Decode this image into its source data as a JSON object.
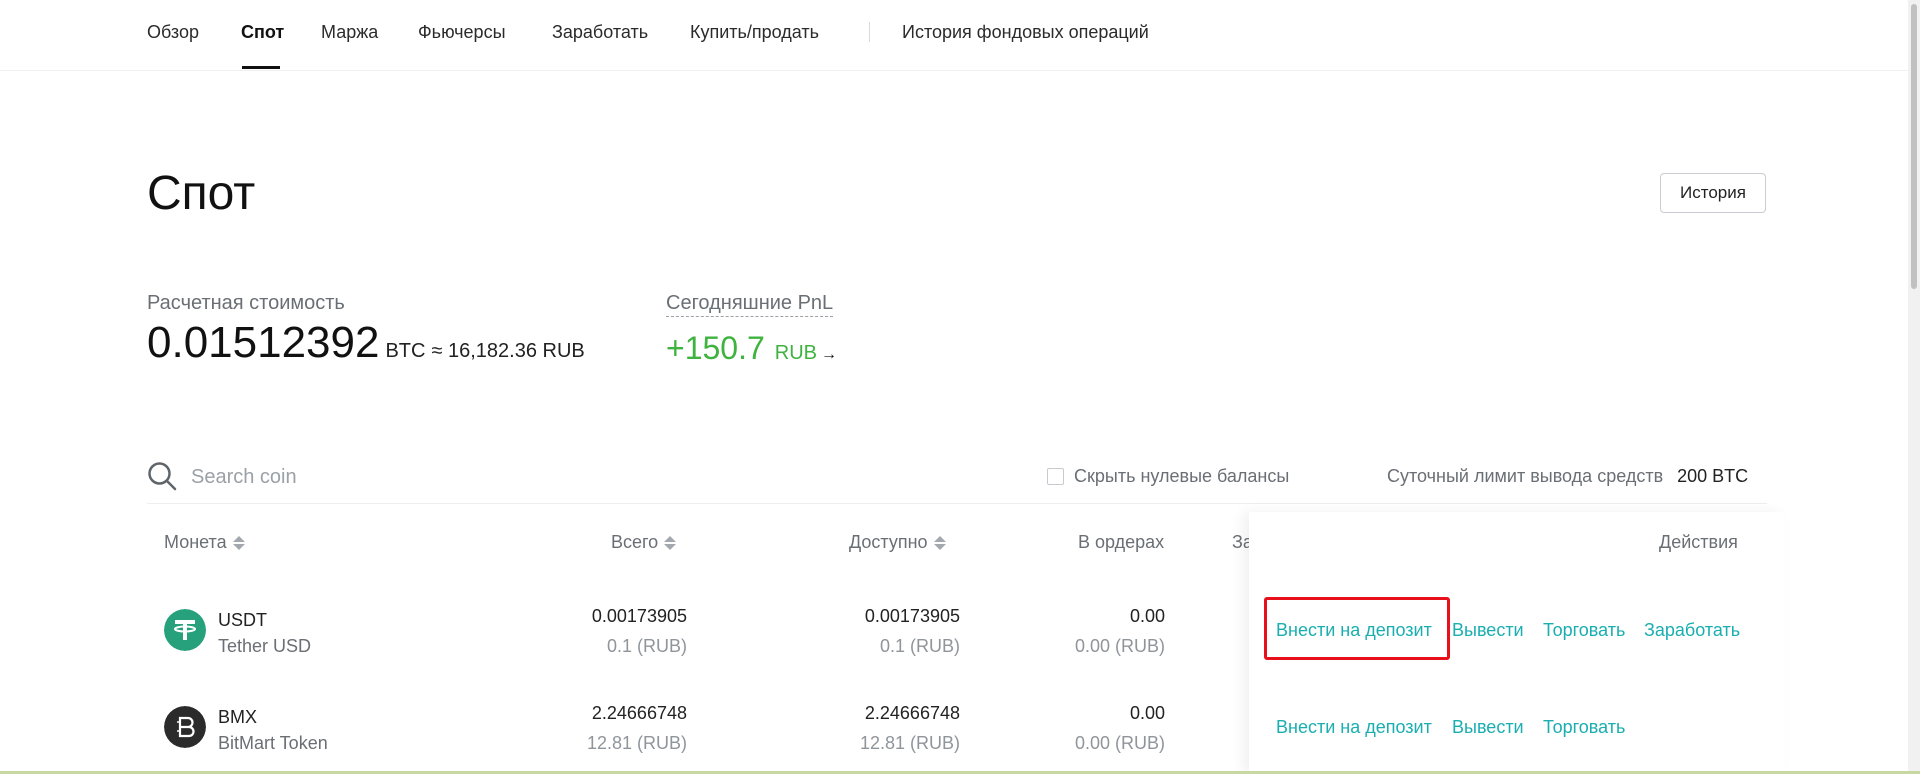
{
  "nav": {
    "tabs": [
      "Обзор",
      "Спот",
      "Маржа",
      "Фьючерсы",
      "Заработать",
      "Купить/продать",
      "История фондовых операций"
    ],
    "active": "Спот"
  },
  "header": {
    "title": "Спот",
    "history_button": "История"
  },
  "estimate": {
    "label": "Расчетная стоимость",
    "value": "0.01512392",
    "unit": "BTC",
    "approx": "≈ 16,182.36 RUB"
  },
  "pnl": {
    "label": "Сегодняшние PnL",
    "value": "+150.7",
    "currency": "RUB",
    "arrow": "→"
  },
  "toolbar": {
    "search_placeholder": "Search coin",
    "hide_zero_label": "Скрыть нулевые балансы",
    "hide_zero_checked": false,
    "limit_label": "Суточный лимит вывода средств",
    "limit_value": "200 BTC"
  },
  "table": {
    "headers": {
      "coin": "Монета",
      "total": "Всего",
      "available": "Доступно",
      "in_orders": "В ордерах",
      "truncated": "За",
      "actions": "Действия"
    },
    "rows": [
      {
        "symbol": "USDT",
        "name": "Tether USD",
        "total": "0.00173905",
        "total_rub": "0.1 (RUB)",
        "available": "0.00173905",
        "available_rub": "0.1 (RUB)",
        "in_orders": "0.00",
        "in_orders_rub": "0.00 (RUB)",
        "actions": [
          "Внести на депозит",
          "Вывести",
          "Торговать",
          "Заработать"
        ]
      },
      {
        "symbol": "BMX",
        "name": "BitMart Token",
        "total": "2.24666748",
        "total_rub": "12.81 (RUB)",
        "available": "2.24666748",
        "available_rub": "12.81 (RUB)",
        "in_orders": "0.00",
        "in_orders_rub": "0.00 (RUB)",
        "actions": [
          "Внести на депозит",
          "Вывести",
          "Торговать"
        ]
      }
    ]
  },
  "colors": {
    "accent": "#1aaeb0",
    "positive": "#3fb33f",
    "highlight": "#e8101b",
    "usdt": "#26a17b",
    "bmx": "#2b2b2b"
  }
}
